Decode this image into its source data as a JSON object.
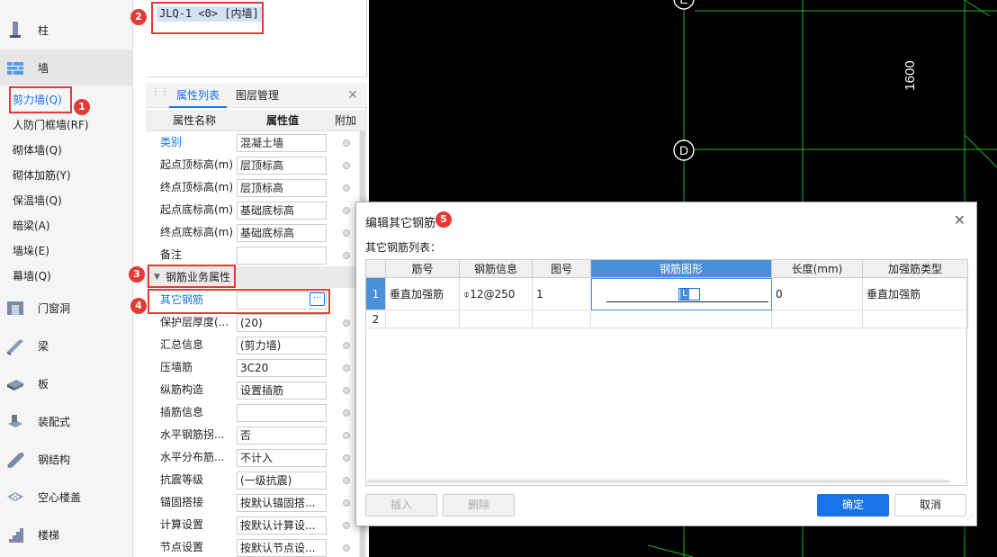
{
  "nav": {
    "categories": [
      {
        "label": "柱",
        "icon": "column-icon"
      },
      {
        "label": "墙",
        "icon": "wall-icon"
      },
      {
        "label": "门窗洞",
        "icon": "door-window-icon"
      },
      {
        "label": "梁",
        "icon": "beam-icon"
      },
      {
        "label": "板",
        "icon": "slab-icon"
      },
      {
        "label": "装配式",
        "icon": "prefab-icon"
      },
      {
        "label": "钢结构",
        "icon": "steel-structure-icon"
      },
      {
        "label": "空心楼盖",
        "icon": "hollow-floor-icon"
      },
      {
        "label": "楼梯",
        "icon": "stair-icon"
      }
    ],
    "wall_items": [
      "剪力墙(Q)",
      "人防门框墙(RF)",
      "砌体墙(Q)",
      "砌体加筋(Y)",
      "保温墙(Q)",
      "暗梁(A)",
      "墙垛(E)",
      "幕墙(Q)"
    ]
  },
  "badges": [
    "1",
    "2",
    "3",
    "4",
    "5"
  ],
  "component": {
    "item": "JLQ-1 <0> [内墙]"
  },
  "props": {
    "tabs": [
      "属性列表",
      "图层管理"
    ],
    "headers": [
      "属性名称",
      "属性值",
      "附加"
    ],
    "rows": [
      {
        "name": "类别",
        "value": "混凝土墙"
      },
      {
        "name": "起点顶标高(m)",
        "value": "层顶标高"
      },
      {
        "name": "终点顶标高(m)",
        "value": "层顶标高"
      },
      {
        "name": "起点底标高(m)",
        "value": "基础底标高"
      },
      {
        "name": "终点底标高(m)",
        "value": "基础底标高"
      },
      {
        "name": "备注",
        "value": ""
      }
    ],
    "group": "钢筋业务属性",
    "rebar_rows": [
      {
        "name": "其它钢筋",
        "value": ""
      },
      {
        "name": "保护层厚度(...",
        "value": "(20)"
      },
      {
        "name": "汇总信息",
        "value": "(剪力墙)"
      },
      {
        "name": "压墙筋",
        "value": "3C20"
      },
      {
        "name": "纵筋构造",
        "value": "设置插筋"
      },
      {
        "name": "插筋信息",
        "value": ""
      },
      {
        "name": "水平钢筋拐...",
        "value": "否"
      },
      {
        "name": "水平分布筋...",
        "value": "不计入"
      },
      {
        "name": "抗震等级",
        "value": "(一级抗震)"
      },
      {
        "name": "锚固搭接",
        "value": "按默认锚固搭..."
      },
      {
        "name": "计算设置",
        "value": "按默认计算设..."
      },
      {
        "name": "节点设置",
        "value": "按默认节点设..."
      }
    ]
  },
  "canvas": {
    "axis_e": "E",
    "axis_d": "D",
    "dimension": "1600"
  },
  "dialog": {
    "title": "编辑其它钢筋",
    "subtitle": "其它钢筋列表：",
    "headers": [
      "筋号",
      "钢筋信息",
      "图号",
      "钢筋图形",
      "长度(mm)",
      "加强筋类型"
    ],
    "rows": [
      {
        "num": "1",
        "name": "垂直加强筋",
        "info": "⌽12@250",
        "fig": "1",
        "shape_label": "L",
        "length": "0",
        "type": "垂直加强筋"
      },
      {
        "num": "2",
        "name": "",
        "info": "",
        "fig": "",
        "shape_label": "",
        "length": "",
        "type": ""
      }
    ],
    "buttons": {
      "insert": "插入",
      "delete": "删除",
      "ok": "确定",
      "cancel": "取消"
    }
  }
}
